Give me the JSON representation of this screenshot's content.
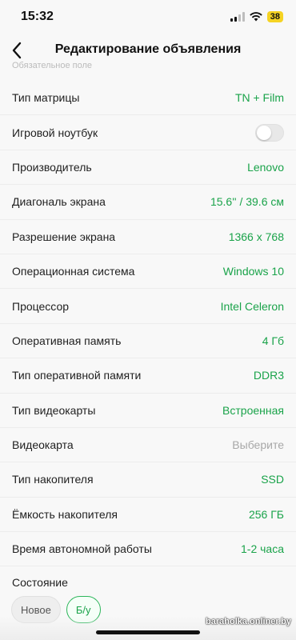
{
  "status_bar": {
    "time": "15:32",
    "battery": "38"
  },
  "header": {
    "title": "Редактирование объявления"
  },
  "hint": "Обязательное поле",
  "rows": [
    {
      "label": "Тип матрицы",
      "value": "TN + Film"
    },
    {
      "label": "Игровой ноутбук",
      "toggle": false
    },
    {
      "label": "Производитель",
      "value": "Lenovo"
    },
    {
      "label": "Диагональ экрана",
      "value": "15.6'' / 39.6 см"
    },
    {
      "label": "Разрешение экрана",
      "value": "1366 x 768"
    },
    {
      "label": "Операционная система",
      "value": "Windows 10"
    },
    {
      "label": "Процессор",
      "value": "Intel Celeron"
    },
    {
      "label": "Оперативная память",
      "value": "4 Гб"
    },
    {
      "label": "Тип оперативной памяти",
      "value": "DDR3"
    },
    {
      "label": "Тип видеокарты",
      "value": "Встроенная"
    },
    {
      "label": "Видеокарта",
      "value": "Выберите",
      "placeholder": true
    },
    {
      "label": "Тип накопителя",
      "value": "SSD"
    },
    {
      "label": "Ёмкость накопителя",
      "value": "256 ГБ"
    },
    {
      "label": "Время автономной работы",
      "value": "1-2 часа"
    }
  ],
  "condition": {
    "label": "Состояние",
    "options": [
      "Новое",
      "Б/у"
    ],
    "selected": "Б/у"
  },
  "watermark": "baraholka.onliner.by",
  "colors": {
    "accent": "#1aa34a",
    "placeholder": "#a8a8a8",
    "battery": "#f5d323"
  },
  "icons": [
    "signal-icon",
    "wifi-icon",
    "battery-icon",
    "back-chevron-icon"
  ]
}
